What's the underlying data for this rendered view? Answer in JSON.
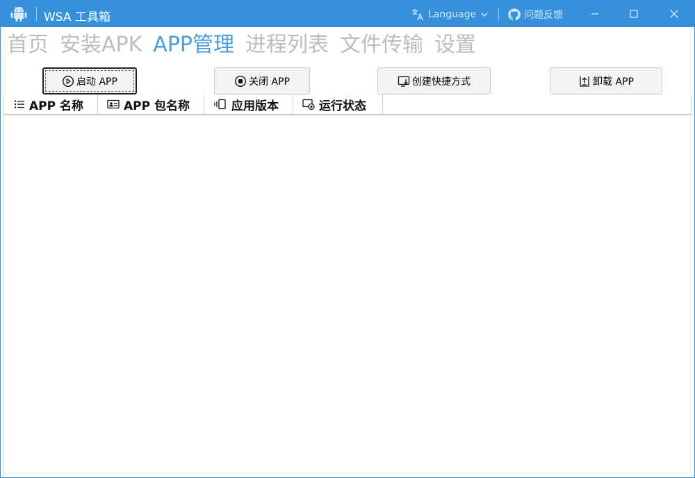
{
  "window": {
    "title": "WSA 工具箱",
    "accent_color": "#3591dc",
    "language_label": "Language",
    "feedback_label": "问题反馈"
  },
  "tabs": [
    {
      "label": "首页",
      "active": false
    },
    {
      "label": "安装APK",
      "active": false
    },
    {
      "label": "APP管理",
      "active": true
    },
    {
      "label": "进程列表",
      "active": false
    },
    {
      "label": "文件传输",
      "active": false
    },
    {
      "label": "设置",
      "active": false
    }
  ],
  "actions": {
    "start": {
      "label": "启动 APP",
      "icon": "play-circle-icon"
    },
    "stop": {
      "label": "关闭 APP",
      "icon": "stop-circle-icon"
    },
    "shortcut": {
      "label": "创建快捷方式",
      "icon": "shortcut-icon"
    },
    "uninstall": {
      "label": "卸载 APP",
      "icon": "uninstall-icon"
    }
  },
  "table": {
    "columns": [
      {
        "label": "APP 名称",
        "icon": "list-icon"
      },
      {
        "label": "APP 包名称",
        "icon": "id-card-icon"
      },
      {
        "label": "应用版本",
        "icon": "version-icon"
      },
      {
        "label": "运行状态",
        "icon": "status-icon"
      }
    ],
    "rows": []
  }
}
